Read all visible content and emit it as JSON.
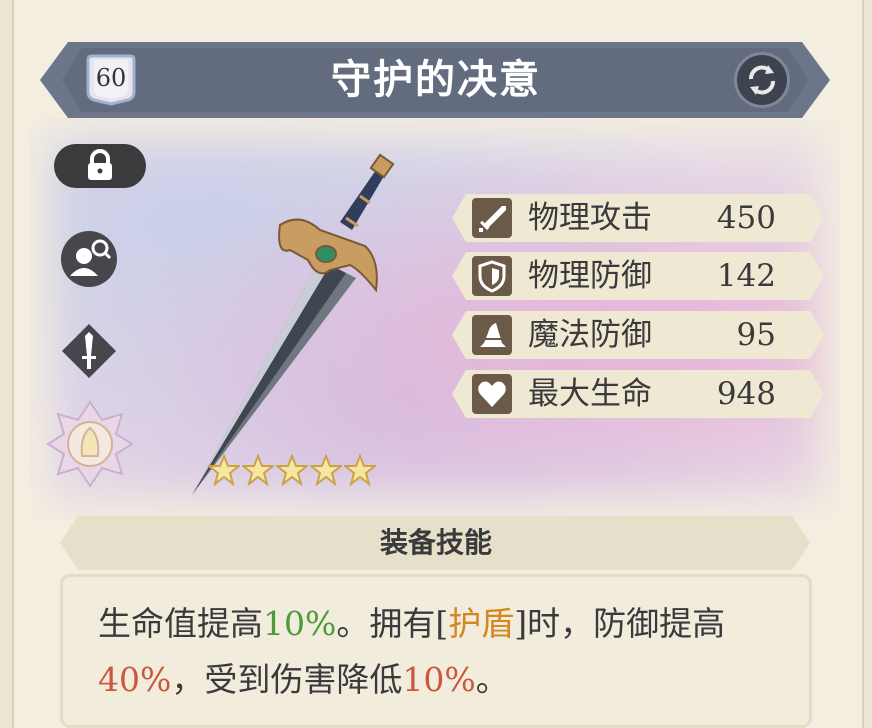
{
  "header": {
    "level": "60",
    "title": "守护的决意"
  },
  "stats": [
    {
      "icon": "sword-icon",
      "label": "物理攻击",
      "value": "450"
    },
    {
      "icon": "shield-icon",
      "label": "物理防御",
      "value": "142"
    },
    {
      "icon": "wizard-hat-icon",
      "label": "魔法防御",
      "value": "95"
    },
    {
      "icon": "heart-icon",
      "label": "最大生命",
      "value": "948"
    }
  ],
  "rarity_stars": 5,
  "skill": {
    "title": "装备技能",
    "parts": [
      {
        "text": "生命值提高",
        "color": "default"
      },
      {
        "text": "10%",
        "color": "green"
      },
      {
        "text": "。拥有[",
        "color": "default"
      },
      {
        "text": "护盾",
        "color": "orange"
      },
      {
        "text": "]时，防御提高",
        "color": "default"
      },
      {
        "text": "40%",
        "color": "red"
      },
      {
        "text": "，受到伤害降低",
        "color": "default"
      },
      {
        "text": "10%",
        "color": "red"
      },
      {
        "text": "。",
        "color": "default"
      }
    ]
  },
  "colors": {
    "banner": "#6d7689",
    "stat_icon_bg": "#6b5a48",
    "green": "#4d9a3a",
    "orange": "#d4861f",
    "red": "#c9583e"
  }
}
